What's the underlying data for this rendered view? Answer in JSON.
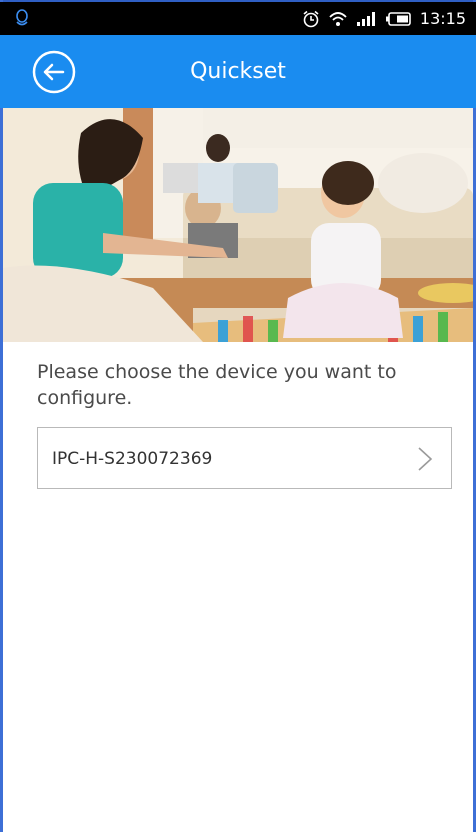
{
  "status_bar": {
    "time": "13:15",
    "icons": [
      "qq-notification-icon",
      "alarm-clock-icon",
      "wifi-icon",
      "signal-icon",
      "battery-icon"
    ]
  },
  "header": {
    "title": "Quickset",
    "back_icon": "back-arrow-circle-icon"
  },
  "colors": {
    "app_bar": "#1a8cf0",
    "status_bar": "#000000",
    "text_primary": "#4a4a4a",
    "border": "#b9b9b9"
  },
  "main": {
    "prompt": "Please choose the device you want to configure.",
    "devices": [
      {
        "name": "IPC-H-S230072369",
        "icon": "chevron-right-icon"
      }
    ]
  }
}
